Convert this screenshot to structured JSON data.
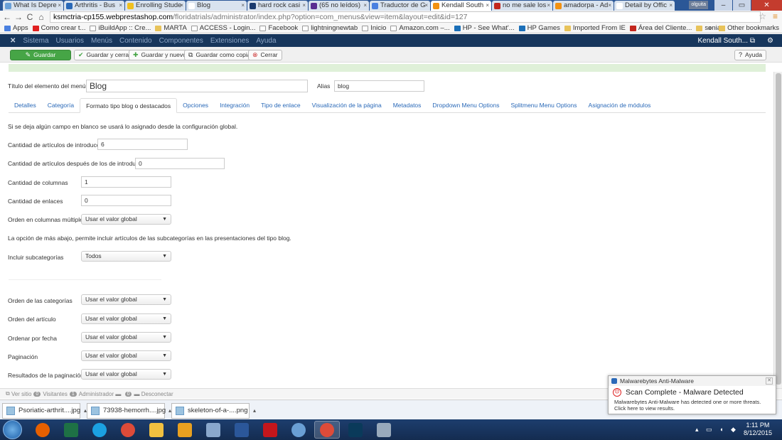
{
  "browser": {
    "tabs": [
      {
        "label": "What Is Depre",
        "color": "#6aa0d8"
      },
      {
        "label": "Arthritis - Bus",
        "color": "#2a69b8"
      },
      {
        "label": "Enrolling Stude",
        "color": "#f0c020"
      },
      {
        "label": "Blog",
        "color": "#ffffff"
      },
      {
        "label": "hard rock casi",
        "color": "#1b3b6f"
      },
      {
        "label": "(65 no leídos)",
        "color": "#5a2d91"
      },
      {
        "label": "Traductor de G",
        "color": "#4a80e0"
      },
      {
        "label": "Kendall South",
        "color": "#f29111",
        "active": true
      },
      {
        "label": "no me sale los",
        "color": "#c3271d"
      },
      {
        "label": "amadorpa - Ad",
        "color": "#f29111"
      },
      {
        "label": "Detail by Offic",
        "color": "#ffffff"
      }
    ],
    "user_badge": "olguita",
    "url_host": "ksmctria-cp155.webprestashop.com",
    "url_path": "/floridatrials/administrator/index.php?option=com_menus&view=item&layout=edit&id=127",
    "bookmarks": [
      {
        "label": "Apps",
        "type": "apps"
      },
      {
        "label": "Como crear t...",
        "type": "youtube"
      },
      {
        "label": "iBuildApp :: Cre...",
        "type": "page"
      },
      {
        "label": "MARTA",
        "type": "folder"
      },
      {
        "label": "ACCESS - Login...",
        "type": "page"
      },
      {
        "label": "Facebook",
        "type": "page"
      },
      {
        "label": "lightningnewtab",
        "type": "page"
      },
      {
        "label": "Inicio",
        "type": "page"
      },
      {
        "label": "Amazon.com –...",
        "type": "page"
      },
      {
        "label": "HP - See What'...",
        "type": "hp"
      },
      {
        "label": "HP Games",
        "type": "hp"
      },
      {
        "label": "Imported From IE",
        "type": "folder"
      },
      {
        "label": "Área del Cliente...",
        "type": "w"
      },
      {
        "label": "sonia",
        "type": "folder"
      }
    ],
    "bookmarks_more": "»",
    "other_bookmarks": "Other bookmarks"
  },
  "admin_nav": {
    "items": [
      "Sistema",
      "Usuarios",
      "Menús",
      "Contenido",
      "Componentes",
      "Extensiones",
      "Ayuda"
    ],
    "user": "Kendall South...",
    "logo_glyph": "✕",
    "settings_glyph": "⚙"
  },
  "toolbar": {
    "save": "Guardar",
    "save_close": "Guardar y cerrar",
    "save_new": "Guardar y nuevo",
    "save_copy": "Guardar como copia",
    "close": "Cerrar",
    "help": "Ayuda"
  },
  "form": {
    "title_label": "Título del elemento del menú *",
    "title_value": "Blog",
    "alias_label": "Alias",
    "alias_value": "blog",
    "tabs": [
      "Detalles",
      "Categoría",
      "Formato tipo blog o destacados",
      "Opciones",
      "Integración",
      "Tipo de enlace",
      "Visualización de la página",
      "Metadatos",
      "Dropdown Menu Options",
      "Splitmenu Menu Options",
      "Asignación de módulos"
    ],
    "active_tab": 2,
    "note1": "Si se deja algún campo en blanco se usará lo asignado desde la configuración global.",
    "intro_label": "Cantidad de artículos de introducción",
    "intro_value": "6",
    "after_intro_label": "Cantidad de artículos después de los de introducción",
    "after_intro_value": "0",
    "columns_label": "Cantidad de columnas",
    "columns_value": "1",
    "links_label": "Cantidad de enlaces",
    "links_value": "0",
    "multi_col_label": "Orden en columnas múltiples",
    "multi_col_value": "Usar el valor global",
    "note2": "La opción de más abajo, permite incluir artículos de las subcategorías en las presentaciones del tipo blog.",
    "subcat_label": "Incluir subcategorías",
    "subcat_value": "Todos",
    "cat_order_label": "Orden de las categorías",
    "cat_order_value": "Usar el valor global",
    "art_order_label": "Orden del artículo",
    "art_order_value": "Usar el valor global",
    "date_order_label": "Ordenar por fecha",
    "date_order_value": "Usar el valor global",
    "pagination_label": "Paginación",
    "pagination_value": "Usar el valor global",
    "pag_results_label": "Resultados de la paginación",
    "pag_results_value": "Usar el valor global"
  },
  "statusbar": {
    "view_site": "Ver sitio",
    "visitors_count": "0",
    "visitors": "Visitantes",
    "admin_count": "1",
    "admin": "Administrador",
    "msg_count": "0",
    "logout": "Desconectar"
  },
  "downloads": [
    "Psoriatic-arthrit....jpg",
    "73938-hemorrh....jpg",
    "skeleton-of-a-....png"
  ],
  "popup": {
    "app": "Malwarebytes Anti-Malware",
    "heading": "Scan Complete - Malware Detected",
    "line1": "Malwarebytes Anti-Malware has detected one or more threats.",
    "line2": "Click here to view results."
  },
  "taskbar": {
    "apps": [
      {
        "name": "firefox",
        "color": "#e66000"
      },
      {
        "name": "excel",
        "color": "#1e7145"
      },
      {
        "name": "ie",
        "color": "#1ba1e2"
      },
      {
        "name": "chrome",
        "color": "#dd4b39"
      },
      {
        "name": "explorer",
        "color": "#f0c040"
      },
      {
        "name": "outlook",
        "color": "#e8a020"
      },
      {
        "name": "calculator",
        "color": "#8aa8cc"
      },
      {
        "name": "word",
        "color": "#2b579a"
      },
      {
        "name": "acrobat",
        "color": "#c4161c"
      },
      {
        "name": "media",
        "color": "#6a9fd4"
      },
      {
        "name": "chrome2",
        "color": "#dd4b39",
        "active": true
      },
      {
        "name": "photoshop",
        "color": "#0a3a5a"
      },
      {
        "name": "tool",
        "color": "#9ab"
      }
    ],
    "time": "1:11 PM",
    "date": "8/12/2015"
  }
}
